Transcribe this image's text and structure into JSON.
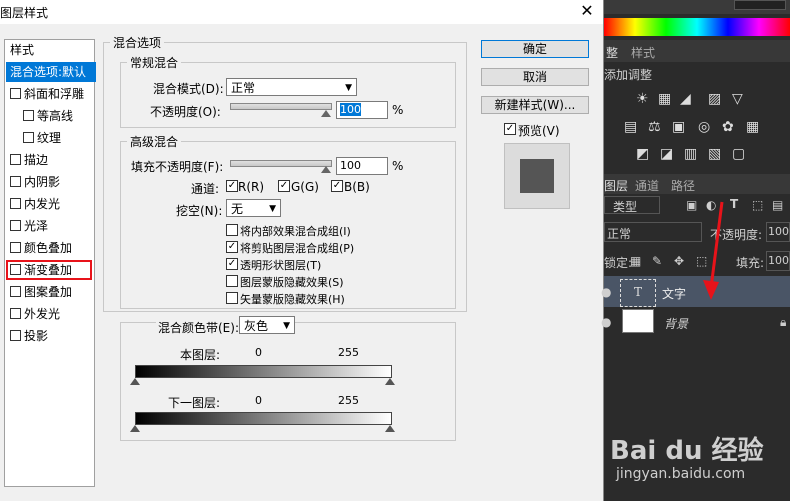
{
  "dialog": {
    "title": "图层样式",
    "close_glyph": "✕",
    "styles_header": "样式",
    "styles": [
      {
        "label": "混合选项:默认",
        "checkbox": false,
        "selected": true,
        "highlighted": false,
        "sub": false
      },
      {
        "label": "斜面和浮雕",
        "checkbox": true,
        "selected": false,
        "highlighted": false,
        "sub": false
      },
      {
        "label": "等高线",
        "checkbox": true,
        "selected": false,
        "highlighted": false,
        "sub": true
      },
      {
        "label": "纹理",
        "checkbox": true,
        "selected": false,
        "highlighted": false,
        "sub": true
      },
      {
        "label": "描边",
        "checkbox": true,
        "selected": false,
        "highlighted": false,
        "sub": false
      },
      {
        "label": "内阴影",
        "checkbox": true,
        "selected": false,
        "highlighted": false,
        "sub": false
      },
      {
        "label": "内发光",
        "checkbox": true,
        "selected": false,
        "highlighted": false,
        "sub": false
      },
      {
        "label": "光泽",
        "checkbox": true,
        "selected": false,
        "highlighted": false,
        "sub": false
      },
      {
        "label": "颜色叠加",
        "checkbox": true,
        "selected": false,
        "highlighted": false,
        "sub": false
      },
      {
        "label": "渐变叠加",
        "checkbox": true,
        "selected": false,
        "highlighted": true,
        "sub": false
      },
      {
        "label": "图案叠加",
        "checkbox": true,
        "selected": false,
        "highlighted": false,
        "sub": false
      },
      {
        "label": "外发光",
        "checkbox": true,
        "selected": false,
        "highlighted": false,
        "sub": false
      },
      {
        "label": "投影",
        "checkbox": true,
        "selected": false,
        "highlighted": false,
        "sub": false
      }
    ],
    "blend_options_title": "混合选项",
    "general": {
      "legend": "常规混合",
      "mode_label": "混合模式(D):",
      "mode_value": "正常",
      "opacity_label": "不透明度(O):",
      "opacity_value": "100",
      "percent": "%"
    },
    "advanced": {
      "legend": "高级混合",
      "fill_label": "填充不透明度(F):",
      "fill_value": "100",
      "percent": "%",
      "channels_label": "通道:",
      "channels": [
        "R(R)",
        "G(G)",
        "B(B)"
      ],
      "knockout_label": "挖空(N):",
      "knockout_value": "无",
      "options": [
        {
          "label": "将内部效果混合成组(I)",
          "checked": false
        },
        {
          "label": "将剪贴图层混合成组(P)",
          "checked": true
        },
        {
          "label": "透明形状图层(T)",
          "checked": true
        },
        {
          "label": "图层蒙版隐藏效果(S)",
          "checked": false
        },
        {
          "label": "矢量蒙版隐藏效果(H)",
          "checked": false
        }
      ]
    },
    "blendif": {
      "label": "混合颜色带(E):",
      "value": "灰色",
      "this_layer_label": "本图层:",
      "this_min": "0",
      "this_max": "255",
      "under_layer_label": "下一图层:",
      "under_min": "0",
      "under_max": "255"
    },
    "buttons": {
      "ok": "确定",
      "cancel": "取消",
      "new_style": "新建样式(W)...",
      "preview_label": "预览(V)",
      "preview_checked": true
    }
  },
  "right_panel": {
    "adjust_tabs": [
      "整",
      "样式"
    ],
    "adjust_hint": "添加调整",
    "layers_tabs": [
      "图层",
      "通道",
      "路径"
    ],
    "kind_filter": "类型",
    "blend_mode": "正常",
    "opacity_label": "不透明度:",
    "opacity_value": "100",
    "lock_label": "锁定:",
    "fill_label": "填充:",
    "fill_value": "100",
    "layers": [
      {
        "name": "文字",
        "type": "text",
        "selected": true
      },
      {
        "name": "背景",
        "type": "background",
        "selected": false
      }
    ],
    "watermark": "Bai du 经验",
    "watermark_url": "jingyan.baidu.com",
    "arrow_color": "#e8131a"
  },
  "colors": {
    "selection_blue": "#0078d7",
    "highlight_red": "#e8131a",
    "panel_dark": "#2b2b2b",
    "layer_selected": "#4a5566"
  }
}
